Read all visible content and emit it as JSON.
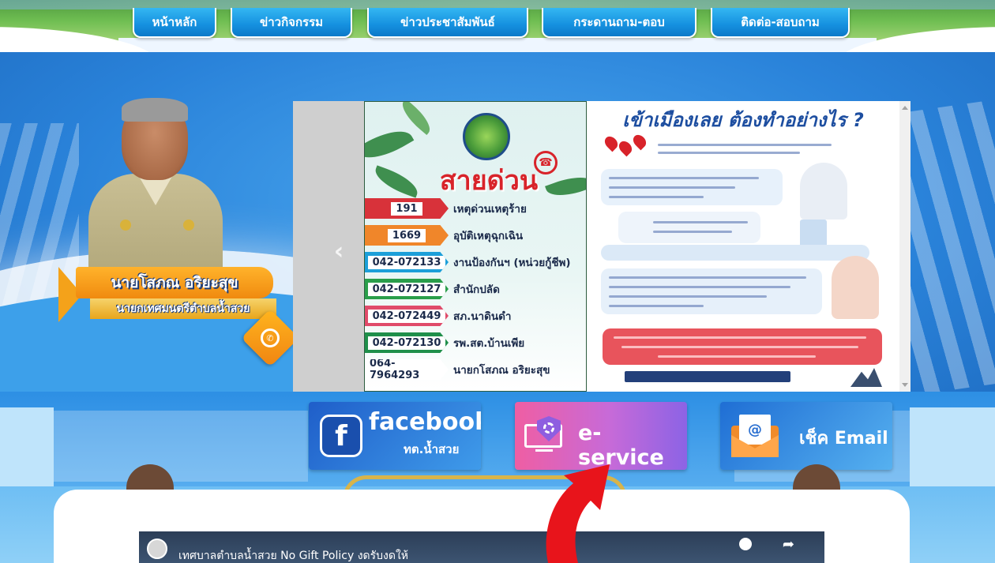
{
  "nav": {
    "items": [
      {
        "label": "หน้าหลัก"
      },
      {
        "label": "ข่าวกิจกรรม"
      },
      {
        "label": "ข่าวประชาสัมพันธ์"
      },
      {
        "label": "กระดานถาม-ตอบ"
      },
      {
        "label": "ติดต่อ-สอบถาม"
      }
    ]
  },
  "mayor": {
    "name": "นายโสภณ  อริยะสุข",
    "title": "นายกเทศมนตรีตำบลน้ำสวย"
  },
  "slider": {
    "poster_hotline": {
      "title": "สายด่วน",
      "rows": [
        {
          "number": "191",
          "desc": "เหตุด่วนเหตุร้าย",
          "color": "#d8323a"
        },
        {
          "number": "1669",
          "desc": "อุบัติเหตุฉุกเฉิน",
          "color": "#f0862a"
        },
        {
          "number": "042-072133",
          "desc": "งานป้องกันฯ (หน่วยกู้ชีพ)",
          "color": "#1c9fd9"
        },
        {
          "number": "042-072127",
          "desc": "สำนักปลัด",
          "color": "#2a9e4a"
        },
        {
          "number": "042-072449",
          "desc": "สภ.นาดินดำ",
          "color": "#e04b6a"
        },
        {
          "number": "042-072130",
          "desc": "รพ.สต.บ้านเพีย",
          "color": "#1f8f4a"
        },
        {
          "number": "064-7964293",
          "desc": "นายกโสภณ อริยะสุข",
          "color": "#2a6fd0"
        }
      ]
    },
    "poster_entry": {
      "title": "เข้าเมืองเลย ต้องทำอย่างไร ?"
    }
  },
  "tiles": {
    "facebook": {
      "label": "facebook",
      "sub": "ทต.น้ำสวย"
    },
    "eservice": {
      "label": "e-service"
    },
    "email": {
      "label": "เช็ค Email"
    }
  },
  "video": {
    "title": "เทศบาลตำบลน้ำสวย No Gift Policy งดรับงดให้"
  },
  "colors": {
    "nav_blue": "#1590df",
    "accent_orange": "#f08a0f",
    "arrow_red": "#e8141b"
  }
}
